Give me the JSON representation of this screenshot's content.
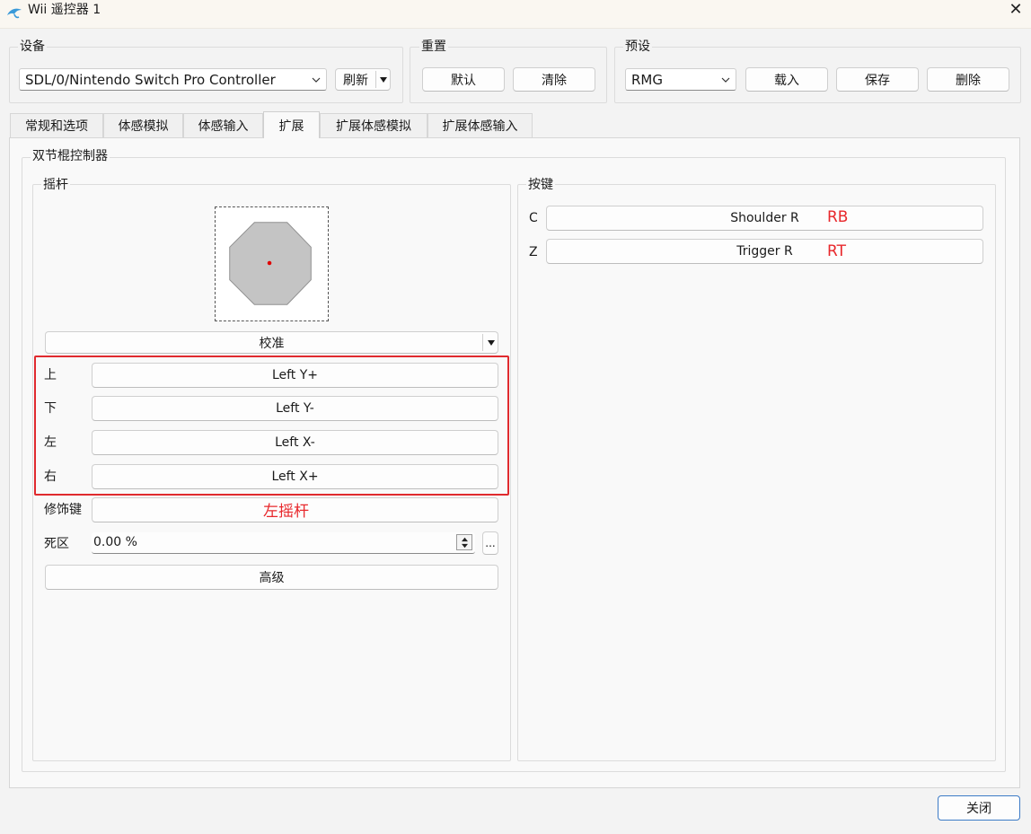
{
  "window": {
    "title": "Wii 遥控器 1",
    "close_glyph": "✕"
  },
  "groups": {
    "device": {
      "title": "设备",
      "selected_device": "SDL/0/Nintendo Switch Pro Controller",
      "refresh_label": "刷新"
    },
    "reset": {
      "title": "重置",
      "default_label": "默认",
      "clear_label": "清除"
    },
    "preset": {
      "title": "预设",
      "selected_preset": "RMG",
      "load_label": "载入",
      "save_label": "保存",
      "delete_label": "删除"
    }
  },
  "tabs": [
    {
      "label": "常规和选项"
    },
    {
      "label": "体感模拟"
    },
    {
      "label": "体感输入"
    },
    {
      "label": "扩展",
      "active": true
    },
    {
      "label": "扩展体感模拟"
    },
    {
      "label": "扩展体感输入"
    }
  ],
  "extension": {
    "title": "双节棍控制器",
    "stick": {
      "title": "摇杆",
      "calibrate_label": "校准",
      "rows": [
        {
          "label": "上",
          "value": "Left Y+"
        },
        {
          "label": "下",
          "value": "Left Y-"
        },
        {
          "label": "左",
          "value": "Left X-"
        },
        {
          "label": "右",
          "value": "Left X+"
        }
      ],
      "modifier_label": "修饰键",
      "modifier_value": "",
      "modifier_annotation": "左摇杆",
      "deadzone_label": "死区",
      "deadzone_value": "0.00 %",
      "more_label": "...",
      "advanced_label": "高级"
    },
    "buttons": {
      "title": "按键",
      "rows": [
        {
          "label": "C",
          "value": "Shoulder R",
          "annotation": "RB"
        },
        {
          "label": "Z",
          "value": "Trigger R",
          "annotation": "RT"
        }
      ]
    }
  },
  "footer": {
    "close_label": "关闭"
  },
  "colors": {
    "annotation_red": "#e8282c",
    "indicator_dot": "#e00000",
    "octagon_fill": "#c4c4c4"
  }
}
